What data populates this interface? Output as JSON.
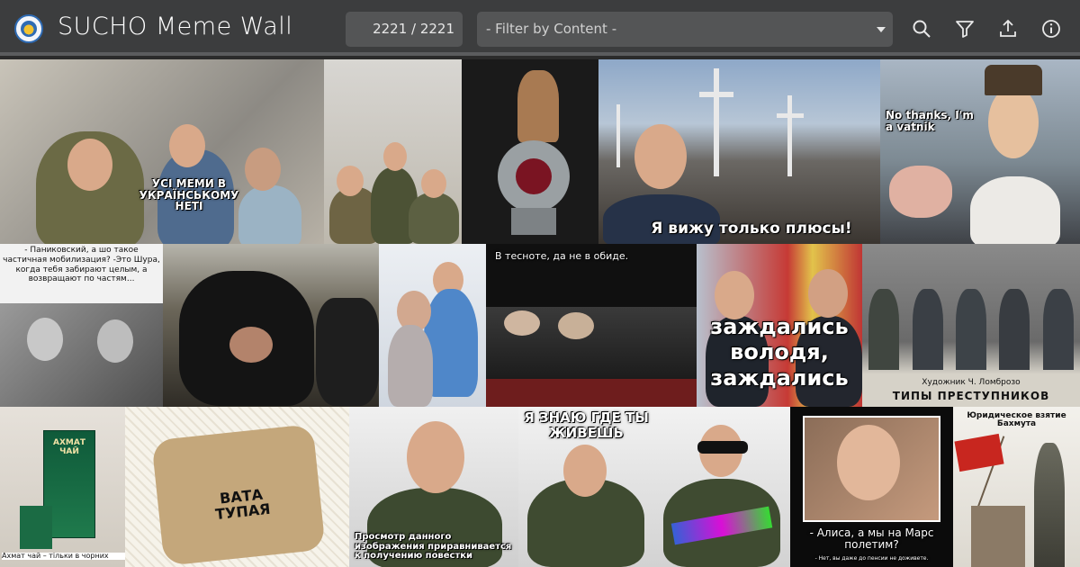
{
  "header": {
    "title": "SUCHO Meme Wall",
    "counter": "2221 / 2221",
    "filter_placeholder": "- Filter by Content -",
    "icons": [
      "search-icon",
      "filter-icon",
      "upload-icon",
      "info-icon"
    ]
  },
  "colors": {
    "header_bg": "#3c3d3e",
    "control_bg": "#545556",
    "header_border": "#5b5c5e"
  },
  "tiles": [
    {
      "name": "tile-distracted-medvedchuk",
      "caption": "УСІ МЕМИ В УКРАЇНСЬКОМУ НЕТІ"
    },
    {
      "name": "tile-military-group",
      "caption": ""
    },
    {
      "name": "tile-meat-grinder",
      "caption": ""
    },
    {
      "name": "tile-putin-graves",
      "caption": "Я вижу только плюсы!"
    },
    {
      "name": "tile-vatnik",
      "caption": "No thanks, I'm a vatnik"
    },
    {
      "name": "tile-panikovsky",
      "caption": "- Паниковский, а шо такое частичная мобилизация? -Это Шура, когда тебя забирают целым, а возвращают по частям..."
    },
    {
      "name": "tile-garbage-bag",
      "caption": ""
    },
    {
      "name": "tile-embrace",
      "caption": ""
    },
    {
      "name": "tile-lenin-coffins",
      "caption": "В тесноте, да не в обиде."
    },
    {
      "name": "tile-zazhdalis",
      "caption": "заждались володя, заждались"
    },
    {
      "name": "tile-politburo",
      "caption": "Художник Ч. Ломброзо",
      "subcaption": "ТИПЫ ПРЕСТУПНИКОВ"
    },
    {
      "name": "tile-akhmat-tea",
      "caption": "Ахмат чай – тільки в чорних",
      "box_label": "АХМАТ ЧАЙ"
    },
    {
      "name": "tile-vata-package",
      "caption": "ВАТА ТУПАЯ"
    },
    {
      "name": "tile-officer-summons",
      "caption": "Просмотр данного изображения приравнивается к получению повестки"
    },
    {
      "name": "tile-officer-know",
      "caption": "Я ЗНАЮ ГДЕ ТЫ ЖИВЕШЬ"
    },
    {
      "name": "tile-officer-glasses",
      "caption": ""
    },
    {
      "name": "tile-alisa-mars",
      "caption": "- Алиса, а мы на Марс полетим?",
      "subcaption": "- Нет, вы даже до пенсии не доживете."
    },
    {
      "name": "tile-bakhmut",
      "caption": "Юридическое взятие Бахмута"
    }
  ]
}
